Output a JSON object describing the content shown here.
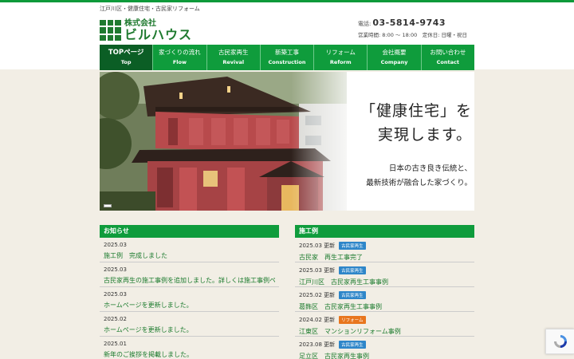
{
  "header": {
    "tagline": "江戸川区・健康住宅・古民家リフォーム",
    "logo_sub": "株式会社",
    "logo_main": "ビルハウス",
    "tel_label": "電話:",
    "tel": "03-5814-9743",
    "hours": "営業時間: 8:00 ～ 18:00　定休日: 日曜・祝日"
  },
  "nav": [
    {
      "jp": "TOPページ",
      "en": "Top"
    },
    {
      "jp": "家づくりの流れ",
      "en": "Flow"
    },
    {
      "jp": "古民家再生",
      "en": "Revival"
    },
    {
      "jp": "新築工事",
      "en": "Construction"
    },
    {
      "jp": "リフォーム",
      "en": "Reform"
    },
    {
      "jp": "会社概要",
      "en": "Company"
    },
    {
      "jp": "お問い合わせ",
      "en": "Contact"
    }
  ],
  "hero": {
    "line1": "「健康住宅」を",
    "line2": "実現します。",
    "sub1": "日本の古き良き伝統と、",
    "sub2": "最新技術が融合した家づくり。"
  },
  "news": {
    "heading": "お知らせ",
    "items": [
      {
        "date": "2025.03",
        "title": "施工例　完成しました"
      },
      {
        "date": "2025.03",
        "title": "古民家再生の施工事例を追加しました。詳しくは施工事例ページをご覧ください。"
      },
      {
        "date": "2025.03",
        "title": "ホームページを更新しました。"
      },
      {
        "date": "2025.02",
        "title": "ホームページを更新しました。"
      },
      {
        "date": "2025.01",
        "title": "新年のご挨拶を掲載しました。"
      }
    ]
  },
  "works": {
    "heading": "施工例",
    "items": [
      {
        "date": "2025.03 更新",
        "badge": "古民家再生",
        "badge_color": "blue",
        "title": "古民家　再生工事完了"
      },
      {
        "date": "2025.03 更新",
        "badge": "古民家再生",
        "badge_color": "blue",
        "title": "江戸川区　古民家再生工事事例"
      },
      {
        "date": "2025.02 更新",
        "badge": "古民家再生",
        "badge_color": "blue",
        "title": "葛飾区　古民家再生工事事例"
      },
      {
        "date": "2024.02 更新",
        "badge": "リフォーム",
        "badge_color": "orange",
        "title": "江東区　マンションリフォーム事例"
      },
      {
        "date": "2023.08 更新",
        "badge": "古民家再生",
        "badge_color": "blue",
        "title": "足立区　古民家再生事例"
      }
    ]
  },
  "colors": {
    "brand_green": "#0f9c3c",
    "dark_green": "#0b5e25",
    "link_green": "#1a7a2c",
    "badge_blue": "#2e86c9",
    "badge_orange": "#e8761e"
  }
}
